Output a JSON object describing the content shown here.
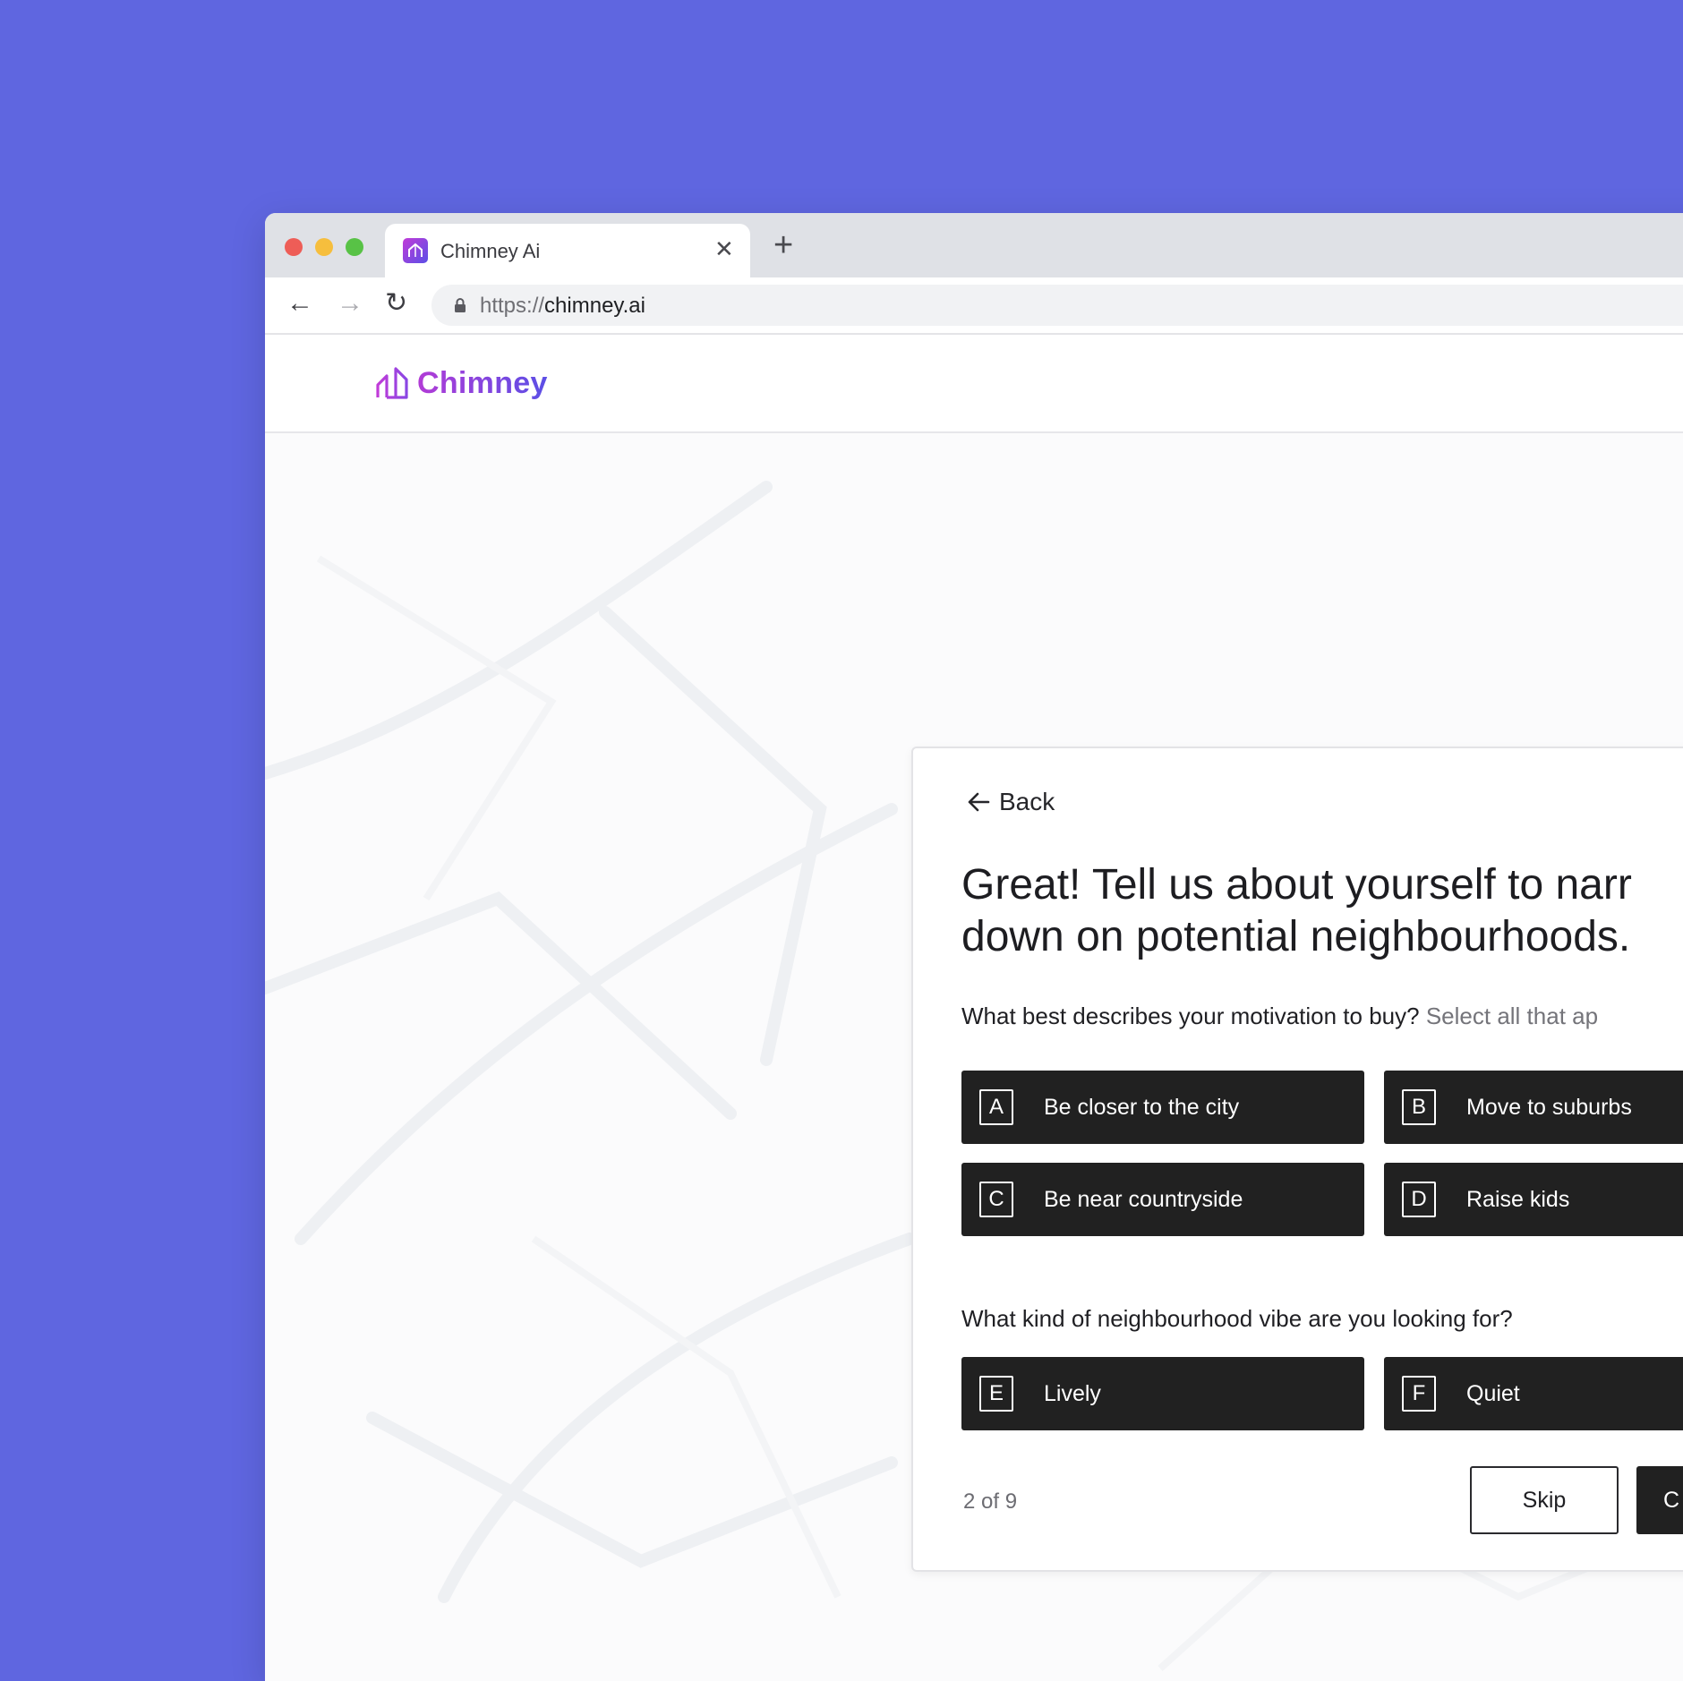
{
  "browser": {
    "tab_title": "Chimney Ai",
    "tab_close_icon": "close-icon",
    "new_tab_icon": "plus-icon",
    "url_scheme": "https://",
    "url_host": "chimney.ai"
  },
  "site": {
    "logo_text": "Chimney",
    "brand_colors": {
      "start": "#b23bd6",
      "end": "#5b4fe6"
    }
  },
  "card": {
    "back_label": "Back",
    "heading_line1": "Great! Tell us about yourself to narr",
    "heading_line2": "down on potential neighbourhoods.",
    "question1": "What best describes your motivation to buy?",
    "question1_hint": "Select all that ap",
    "options1": [
      {
        "key": "A",
        "label": "Be closer to the city"
      },
      {
        "key": "B",
        "label": "Move to suburbs"
      },
      {
        "key": "C",
        "label": "Be near countryside"
      },
      {
        "key": "D",
        "label": "Raise kids"
      }
    ],
    "question2": "What kind of neighbourhood vibe are you looking for?",
    "options2": [
      {
        "key": "E",
        "label": "Lively"
      },
      {
        "key": "F",
        "label": "Quiet"
      }
    ],
    "progress": "2 of 9",
    "skip_label": "Skip",
    "continue_label": "C"
  },
  "colors": {
    "backdrop": "#5f66e0",
    "option_bg": "#212121"
  }
}
